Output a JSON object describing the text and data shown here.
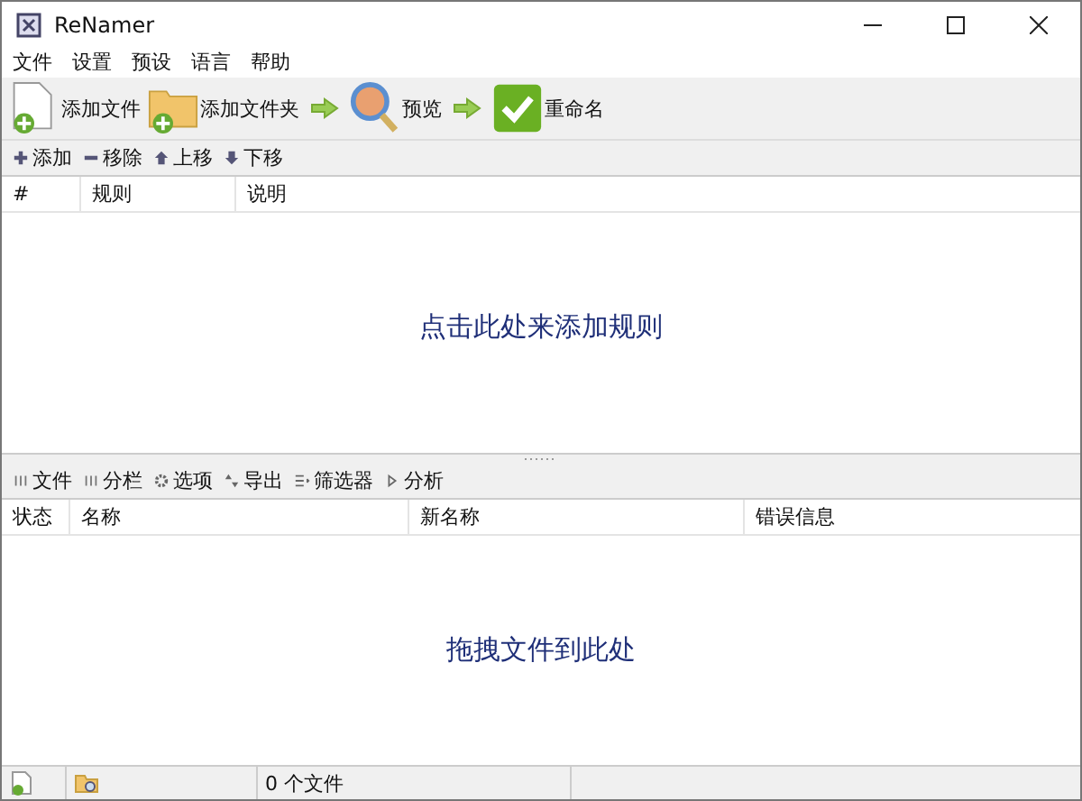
{
  "window": {
    "title": "ReNamer"
  },
  "menu": [
    "文件",
    "设置",
    "预设",
    "语言",
    "帮助"
  ],
  "toolbar": [
    {
      "kind": "file",
      "label": "添加文件"
    },
    {
      "kind": "folder",
      "label": "添加文件夹"
    },
    {
      "kind": "arrow"
    },
    {
      "kind": "preview",
      "label": "预览"
    },
    {
      "kind": "arrow"
    },
    {
      "kind": "rename",
      "label": "重命名"
    }
  ],
  "rules_toolbar": [
    {
      "kind": "plus",
      "label": "添加"
    },
    {
      "kind": "minus",
      "label": "移除"
    },
    {
      "kind": "up",
      "label": "上移"
    },
    {
      "kind": "down",
      "label": "下移"
    }
  ],
  "rules_table": {
    "columns": [
      "#",
      "规则",
      "说明"
    ],
    "hint": "点击此处来添加规则"
  },
  "files_toolbar": [
    {
      "kind": "cols",
      "label": "文件"
    },
    {
      "kind": "cols",
      "label": "分栏"
    },
    {
      "kind": "gear",
      "label": "选项"
    },
    {
      "kind": "updown",
      "label": "导出"
    },
    {
      "kind": "filter",
      "label": "筛选器"
    },
    {
      "kind": "play",
      "label": "分析"
    }
  ],
  "files_table": {
    "columns": [
      "状态",
      "名称",
      "新名称",
      "错误信息"
    ],
    "hint": "拖拽文件到此处"
  },
  "status_bar": {
    "count": "0 个文件"
  }
}
